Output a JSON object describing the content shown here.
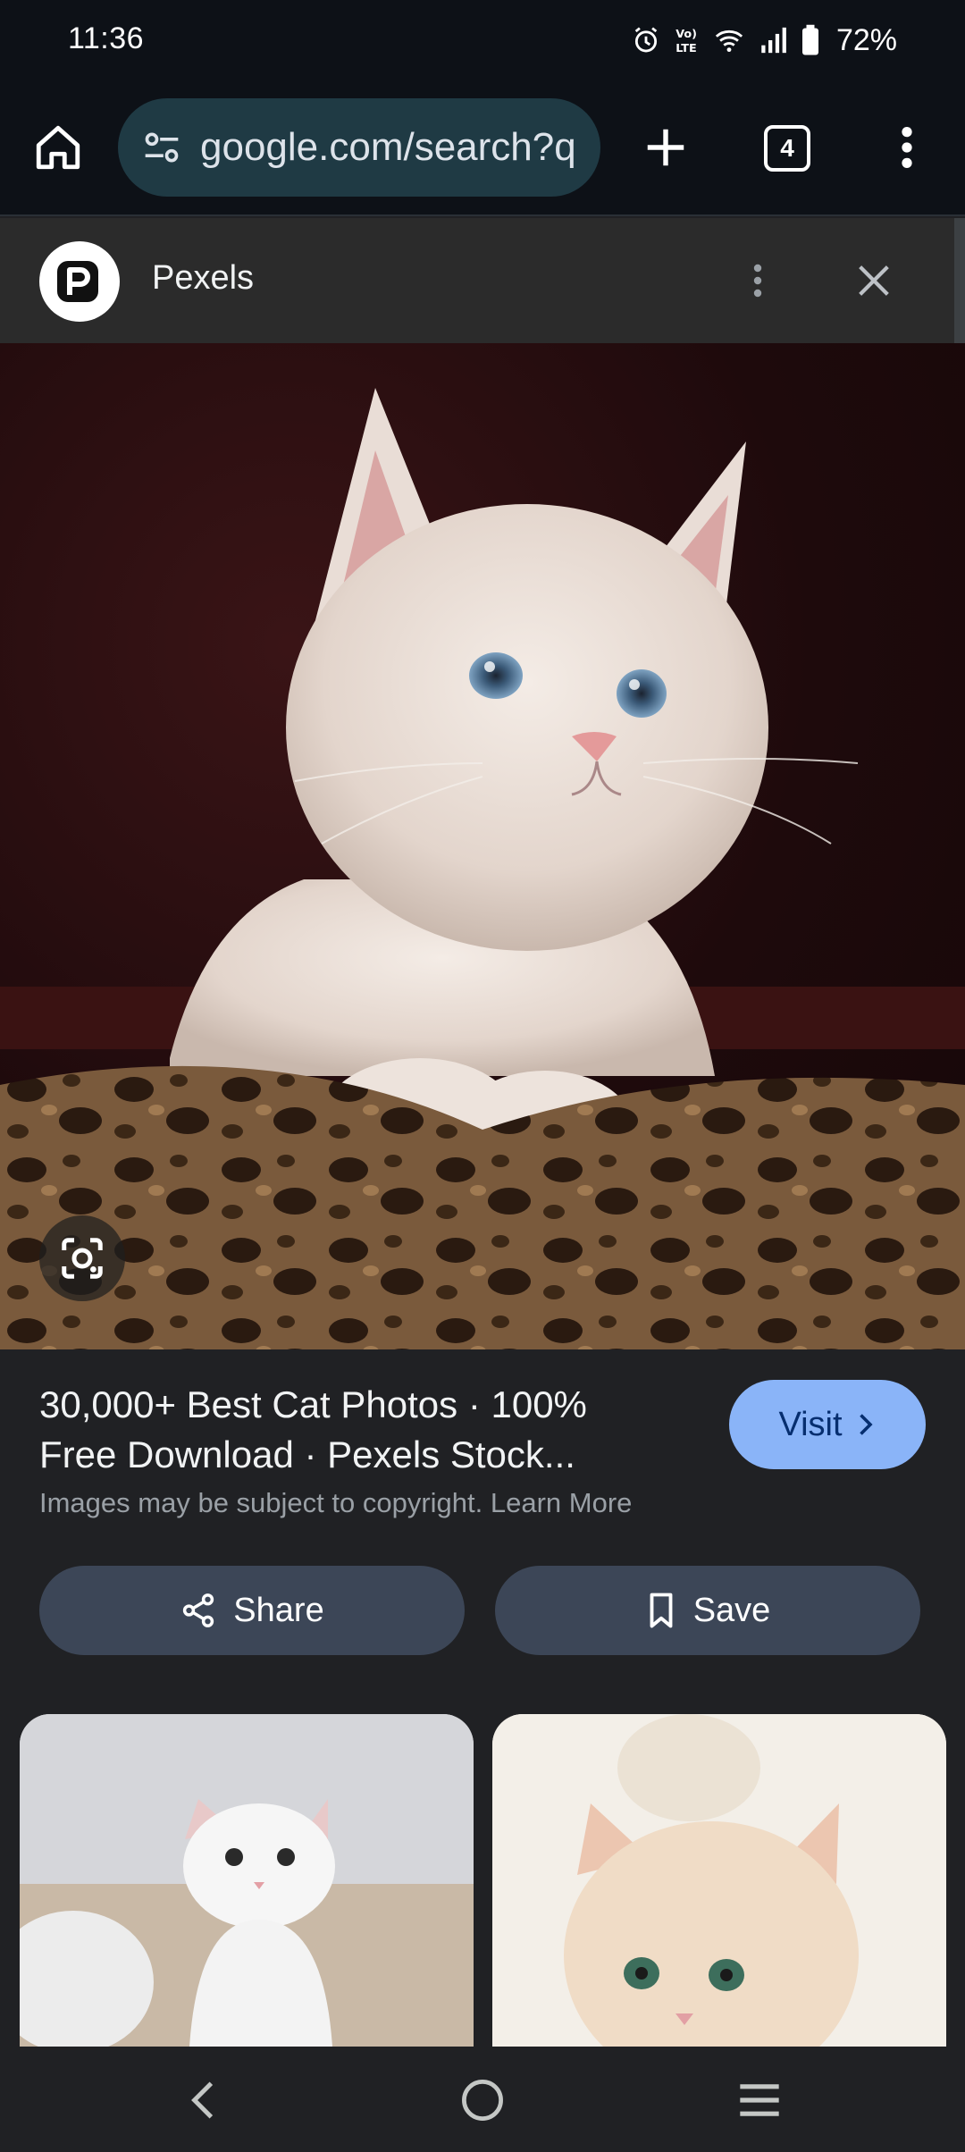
{
  "status_bar": {
    "time": "11:36",
    "battery_percent": "72%",
    "icons": [
      "alarm-icon",
      "volte-icon",
      "wifi-icon",
      "signal-icon",
      "battery-icon"
    ]
  },
  "toolbar": {
    "url": "google.com/search?q",
    "tab_count": "4",
    "icons": [
      "home-icon",
      "site-settings-icon",
      "plus-icon",
      "tab-switcher-icon",
      "more-vert-icon"
    ]
  },
  "source": {
    "name": "Pexels",
    "icons": [
      "pexels-logo",
      "more-vert-icon",
      "close-icon"
    ]
  },
  "result": {
    "title_line1": "30,000+ Best Cat Photos · 100%",
    "title_line2": "Free Download · Pexels Stock...",
    "copyright_text": "Images may be subject to copyright.",
    "learn_more": "Learn More",
    "visit_label": "Visit"
  },
  "actions": {
    "share_label": "Share",
    "save_label": "Save"
  },
  "colors": {
    "accent_blue": "#8ab4f8",
    "chip_bg": "#3c4657",
    "page_bg": "#202124",
    "omnibox_bg": "#1f3a44"
  },
  "nav": {
    "icons": [
      "back-icon",
      "home-circle-icon",
      "recents-icon"
    ]
  }
}
